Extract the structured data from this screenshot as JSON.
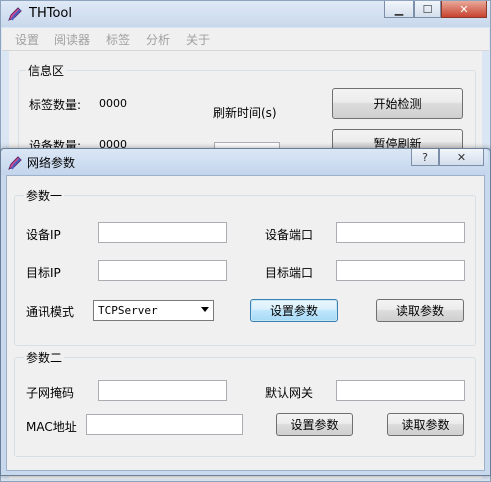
{
  "main_window": {
    "title": "THTool",
    "menu": [
      "设置",
      "阅读器",
      "标签",
      "分析",
      "关于"
    ],
    "info_group": {
      "title": "信息区",
      "tag_count_label": "标签数量:",
      "tag_count_value": "0000",
      "refresh_time_label": "刷新时间(s)",
      "device_count_label": "设备数量:",
      "device_count_value": "0000",
      "start_detect_button": "开始检测",
      "pause_refresh_button": "暂停刷新"
    }
  },
  "dialog": {
    "title": "网络参数",
    "help_glyph": "?",
    "close_glyph": "✕",
    "group1": {
      "title": "参数一",
      "device_ip_label": "设备IP",
      "device_ip_value": "",
      "device_port_label": "设备端口",
      "device_port_value": "",
      "target_ip_label": "目标IP",
      "target_ip_value": "",
      "target_port_label": "目标端口",
      "target_port_value": "",
      "comm_mode_label": "通讯模式",
      "comm_mode_value": "TCPServer",
      "set_button": "设置参数",
      "read_button": "读取参数"
    },
    "group2": {
      "title": "参数二",
      "subnet_mask_label": "子网掩码",
      "subnet_mask_value": "",
      "gateway_label": "默认网关",
      "gateway_value": "",
      "mac_label": "MAC地址",
      "mac_value": "",
      "set_button": "设置参数",
      "read_button": "读取参数"
    }
  },
  "colors": {
    "titlebar": "#c8d8ec",
    "window_bg": "#f0f0f0",
    "close_button": "#c8432f",
    "menu_disabled_text": "#a0a0a0"
  },
  "icons": {
    "app_icon": "pencil-icon",
    "dialog_icon": "pencil-icon"
  }
}
